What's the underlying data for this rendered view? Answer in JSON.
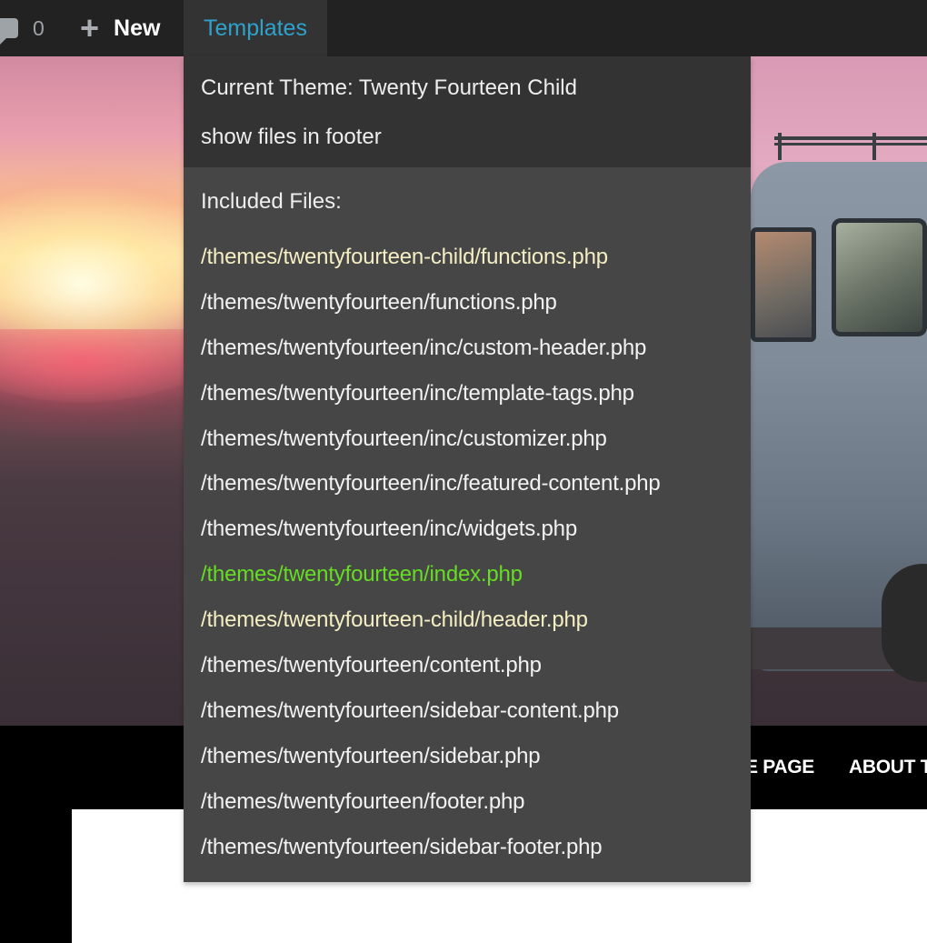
{
  "admin_bar": {
    "comments_icon": "comment-bubble-icon",
    "comments_count": "0",
    "new_icon": "plus-icon",
    "new_label": "New",
    "templates_label": "Templates",
    "templates_color": "#2ea2cc"
  },
  "dropdown": {
    "current_theme": "Current Theme: Twenty Fourteen Child",
    "show_files": "show files in footer",
    "included_heading": "Included Files:",
    "files": [
      {
        "path": "/themes/twentyfourteen-child/functions.php",
        "kind": "child"
      },
      {
        "path": "/themes/twentyfourteen/functions.php",
        "kind": "parent"
      },
      {
        "path": "/themes/twentyfourteen/inc/custom-header.php",
        "kind": "parent"
      },
      {
        "path": "/themes/twentyfourteen/inc/template-tags.php",
        "kind": "parent"
      },
      {
        "path": "/themes/twentyfourteen/inc/customizer.php",
        "kind": "parent"
      },
      {
        "path": "/themes/twentyfourteen/inc/featured-content.php",
        "kind": "parent"
      },
      {
        "path": "/themes/twentyfourteen/inc/widgets.php",
        "kind": "parent"
      },
      {
        "path": "/themes/twentyfourteen/index.php",
        "kind": "current"
      },
      {
        "path": "/themes/twentyfourteen-child/header.php",
        "kind": "child"
      },
      {
        "path": "/themes/twentyfourteen/content.php",
        "kind": "parent"
      },
      {
        "path": "/themes/twentyfourteen/sidebar-content.php",
        "kind": "parent"
      },
      {
        "path": "/themes/twentyfourteen/sidebar.php",
        "kind": "parent"
      },
      {
        "path": "/themes/twentyfourteen/footer.php",
        "kind": "parent"
      },
      {
        "path": "/themes/twentyfourteen/sidebar-footer.php",
        "kind": "parent"
      }
    ],
    "colors": {
      "child": "#f4eec2",
      "parent": "#f2f2f2",
      "current": "#66dd22"
    }
  },
  "site_nav": {
    "items": [
      "E PAGE",
      "ABOUT T"
    ]
  }
}
